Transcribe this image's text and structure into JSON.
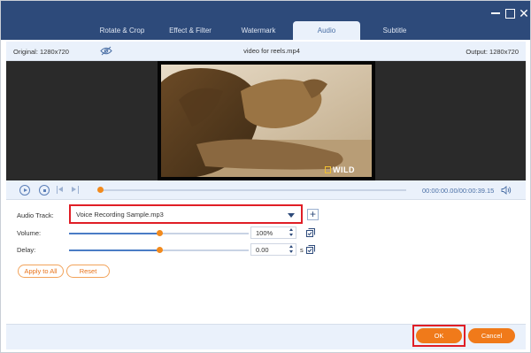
{
  "window": {
    "controls": [
      "minimize-icon",
      "restore-icon",
      "close-icon"
    ],
    "close_glyph": "✕"
  },
  "tabs": [
    {
      "label": "Rotate & Crop",
      "active": false
    },
    {
      "label": "Effect & Filter",
      "active": false
    },
    {
      "label": "Watermark",
      "active": false
    },
    {
      "label": "Audio",
      "active": true
    },
    {
      "label": "Subtitle",
      "active": false
    }
  ],
  "infobar": {
    "original": "Original: 1280x720",
    "filename": "video for reels.mp4",
    "output": "Output: 1280x720"
  },
  "preview": {
    "logo_text": "WILD"
  },
  "playback": {
    "current_time": "00:00:00.00",
    "separator": "/",
    "total_time": "00:00:39.15",
    "progress": 0.0
  },
  "audio": {
    "track_label": "Audio Track:",
    "track_value": "Voice Recording Sample.mp3",
    "volume_label": "Volume:",
    "volume_value": "100%",
    "volume_level": 0.5,
    "delay_label": "Delay:",
    "delay_value": "0.00",
    "delay_unit": "s",
    "delay_level": 0.5,
    "apply_all_label": "Apply to All",
    "reset_label": "Reset"
  },
  "footer": {
    "ok_label": "OK",
    "cancel_label": "Cancel"
  },
  "colors": {
    "titlebar": "#2d4a7a",
    "accent_orange": "#f07a1a",
    "highlight_red": "#e01e26",
    "panel_light": "#eaf1fb"
  }
}
